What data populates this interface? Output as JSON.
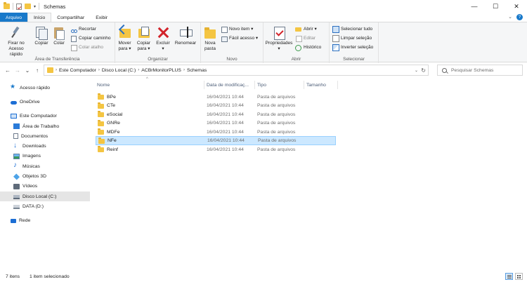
{
  "window": {
    "title": "Schemas",
    "controls": {
      "minimize": "—",
      "maximize": "☐",
      "close": "✕"
    }
  },
  "tabs": [
    {
      "label": "Arquivo"
    },
    {
      "label": "Início"
    },
    {
      "label": "Compartilhar"
    },
    {
      "label": "Exibir"
    }
  ],
  "ribbon": {
    "clipboard": {
      "group_label": "Área de Transferência",
      "pin_label_1": "Fixar no",
      "pin_label_2": "Acesso rápido",
      "copy_label": "Copiar",
      "paste_label": "Colar",
      "cut_label": "Recortar",
      "copy_path_label": "Copiar caminho",
      "paste_shortcut_label": "Colar atalho"
    },
    "organize": {
      "group_label": "Organizar",
      "move_label_1": "Mover",
      "move_label_2": "para ▾",
      "copyto_label_1": "Copiar",
      "copyto_label_2": "para ▾",
      "delete_label_1": "Excluir",
      "delete_label_2": "▾",
      "rename_label": "Renomear"
    },
    "new": {
      "group_label": "Novo",
      "new_folder_label_1": "Nova",
      "new_folder_label_2": "pasta",
      "new_item_label": "Novo item ▾",
      "easy_access_label": "Fácil acesso ▾"
    },
    "open": {
      "group_label": "Abrir",
      "properties_label_1": "Propriedades",
      "properties_label_2": "▾",
      "open_label": "Abrir ▾",
      "edit_label": "Editar",
      "history_label": "Histórico"
    },
    "select": {
      "group_label": "Selecionar",
      "select_all_label": "Selecionar tudo",
      "select_none_label": "Limpar seleção",
      "invert_label": "Inverter seleção"
    }
  },
  "address": {
    "crumbs": [
      "Este Computador",
      "Disco Local (C:)",
      "ACBrMonitorPLUS",
      "Schemas"
    ],
    "search_placeholder": "Pesquisar Schemas"
  },
  "nav_pane": {
    "items": [
      {
        "label": "Acesso rápido"
      },
      {
        "label": "OneDrive"
      },
      {
        "label": "Este Computador"
      },
      {
        "label": "Área de Trabalho"
      },
      {
        "label": "Documentos"
      },
      {
        "label": "Downloads"
      },
      {
        "label": "Imagens"
      },
      {
        "label": "Músicas"
      },
      {
        "label": "Objetos 3D"
      },
      {
        "label": "Vídeos"
      },
      {
        "label": "Disco Local (C:)"
      },
      {
        "label": "DATA (D:)"
      },
      {
        "label": "Rede"
      }
    ]
  },
  "file_list": {
    "columns": {
      "name": "Nome",
      "date": "Data de modificaç...",
      "type": "Tipo",
      "size": "Tamanho"
    },
    "rows": [
      {
        "name": "BPe",
        "date": "16/04/2021 10:44",
        "type": "Pasta de arquivos"
      },
      {
        "name": "CTe",
        "date": "16/04/2021 10:44",
        "type": "Pasta de arquivos"
      },
      {
        "name": "eSocial",
        "date": "16/04/2021 10:44",
        "type": "Pasta de arquivos"
      },
      {
        "name": "GNRe",
        "date": "16/04/2021 10:44",
        "type": "Pasta de arquivos"
      },
      {
        "name": "MDFe",
        "date": "16/04/2021 10:44",
        "type": "Pasta de arquivos"
      },
      {
        "name": "NFe",
        "date": "16/04/2021 10:44",
        "type": "Pasta de arquivos"
      },
      {
        "name": "Reinf",
        "date": "16/04/2021 10:44",
        "type": "Pasta de arquivos"
      }
    ]
  },
  "status": {
    "item_count": "7 itens",
    "selection": "1 item selecionado"
  },
  "colors": {
    "accent": "#1979ca",
    "selection_bg": "#cce8ff",
    "selection_border": "#99d1ff",
    "folder": "#f4c542"
  }
}
